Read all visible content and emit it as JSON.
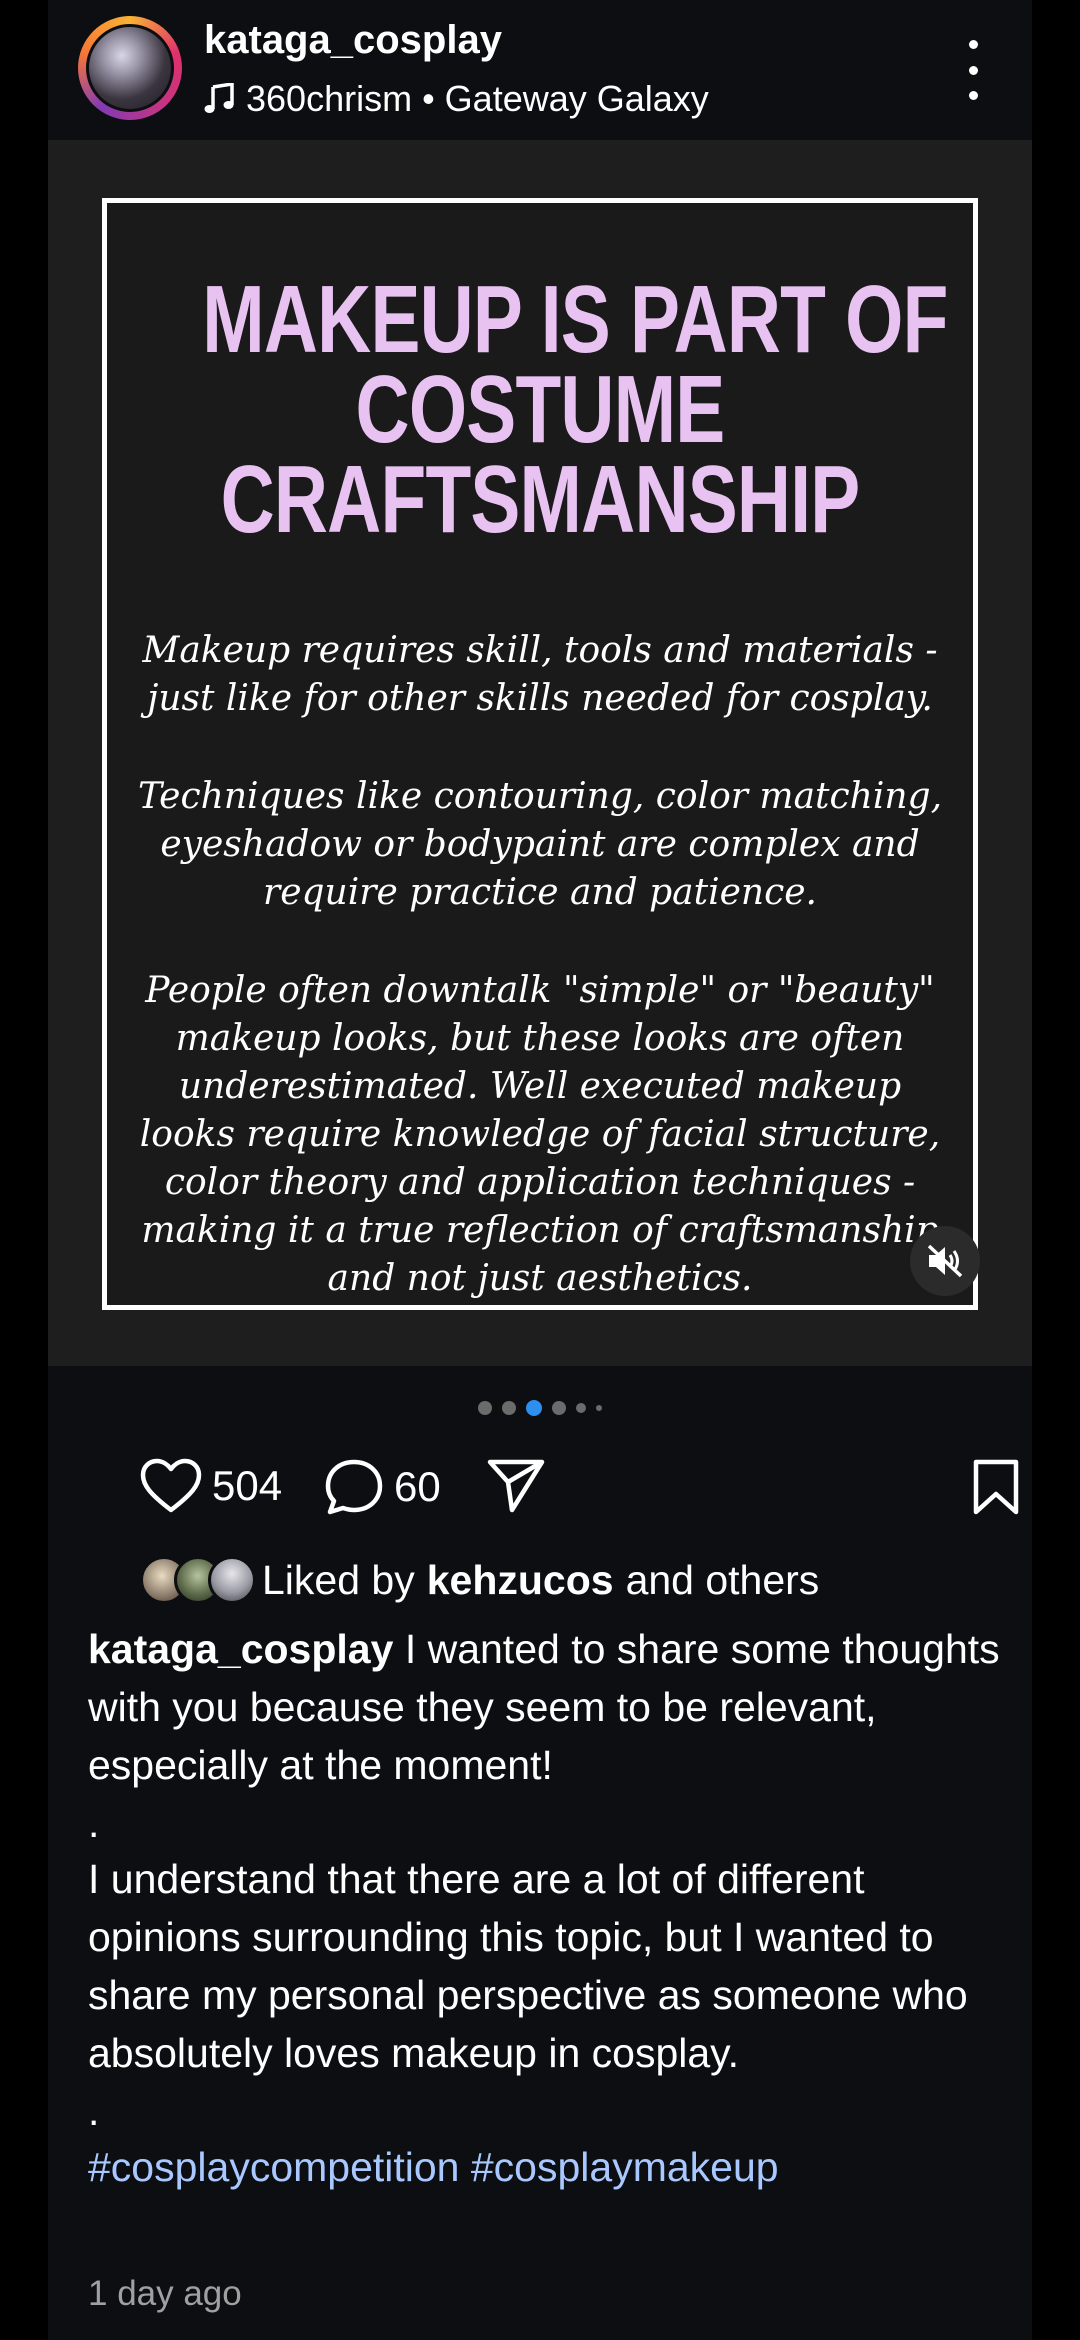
{
  "header": {
    "username": "kataga_cosplay",
    "music": "360chrism • Gateway Galaxy"
  },
  "media": {
    "headline": [
      "MAKEUP IS PART OF",
      "COSTUME",
      "CRAFTSMANSHIP"
    ],
    "paragraphs": [
      "Makeup requires skill, tools and materials - just like for other skills needed for cosplay.",
      "Techniques like contouring, color matching, eyeshadow or bodypaint are complex and require practice and patience.",
      "People often downtalk \"simple\" or \"beauty\" makeup looks, but these looks are often underestimated. Well executed makeup looks require knowledge of facial structure, color theory and application techniques - making it a true reflection of craftsmanship and not just aesthetics."
    ],
    "headline_color": "#e8c3f2"
  },
  "carousel": {
    "active_index": 2,
    "active_color": "#2d8ff0"
  },
  "actions": {
    "likes_count": "504",
    "comments_count": "60"
  },
  "liked_by": {
    "prefix": "Liked by",
    "user": "kehzucos",
    "suffix": "and others"
  },
  "caption": {
    "author": "kataga_cosplay",
    "text1": "I wanted to share some thoughts with you because they seem to be relevant, especially at the moment!",
    "dot1": ".",
    "text2": "I understand that there are a lot of different opinions surrounding this topic, but I wanted to share my personal perspective as someone who absolutely loves makeup in cosplay.",
    "dot2": ".",
    "hashtags": "#cosplaycompetition #cosplaymakeup",
    "hashtag_color": "#a9c8ff"
  },
  "timestamp": "1 day ago"
}
